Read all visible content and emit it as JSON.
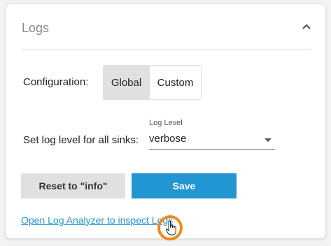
{
  "panel": {
    "title": "Logs",
    "collapse_icon": "chevron-up-icon"
  },
  "configuration": {
    "label": "Configuration:",
    "options": [
      "Global",
      "Custom"
    ],
    "selected": "Global"
  },
  "log_level": {
    "label": "Set log level for all sinks:",
    "field_caption": "Log Level",
    "value": "verbose",
    "dropdown_icon": "caret-down-icon"
  },
  "actions": {
    "reset_label": "Reset to \"info\"",
    "save_label": "Save"
  },
  "link": {
    "text": "Open Log Analyzer to inspect Logs"
  },
  "colors": {
    "accent": "#2196d3",
    "highlight_ring": "#f08a1c",
    "secondary_button": "#e0e0e0"
  },
  "cursor": {
    "icon": "hand-pointer-icon"
  }
}
